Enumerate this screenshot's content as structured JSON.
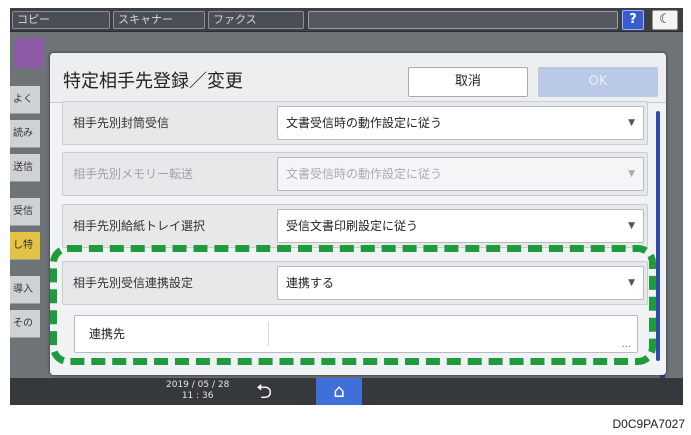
{
  "topbar": {
    "tabs": [
      "コピー",
      "スキャナー",
      "ファクス"
    ],
    "help_label": "?",
    "night_label": "☾"
  },
  "background": {
    "sidebar_items": [
      "よく",
      "読み",
      "送信",
      "受信",
      "し特",
      "導入",
      "その"
    ]
  },
  "dialog": {
    "title": "特定相手先登録／変更",
    "cancel_label": "取消",
    "ok_label": "OK",
    "rows": [
      {
        "label": "相手先別封筒受信",
        "value": "文書受信時の動作設定に従う"
      },
      {
        "label": "相手先別メモリー転送",
        "value": "文書受信時の動作設定に従う"
      },
      {
        "label": "相手先別給紙トレイ選択",
        "value": "受信文書印刷設定に従う"
      },
      {
        "label": "相手先別受信連携設定",
        "value": "連携する"
      }
    ],
    "destination": {
      "label": "連携先",
      "ellipsis": "..."
    }
  },
  "bottombar": {
    "date": "2019 / 05 / 28",
    "time": "11 : 36",
    "back_icon": "⮌",
    "home_icon": "⌂"
  },
  "caption": "D0C9PA7027",
  "colors": {
    "highlight": "#1f9a3c",
    "accent_blue": "#3f6fd8",
    "ok_disabled": "#b9c9e6"
  }
}
